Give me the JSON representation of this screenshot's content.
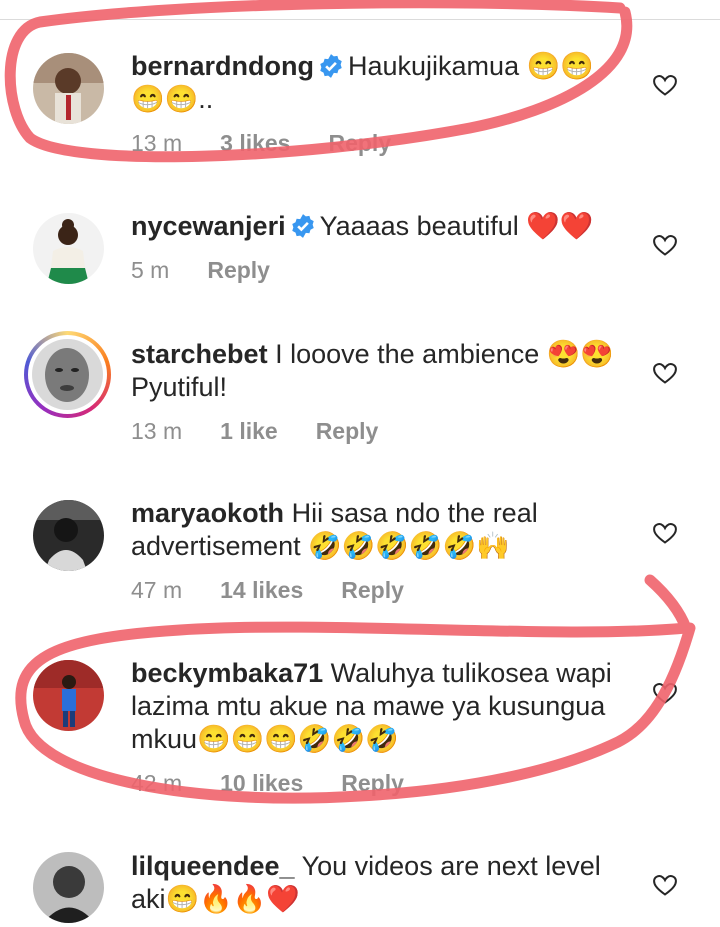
{
  "comments": [
    {
      "username": "bernardndong",
      "verified": true,
      "text": "Haukujikamua 😁😁\n😁😁..",
      "time": "13 m",
      "likes": "3 likes",
      "reply": "Reply"
    },
    {
      "username": "nycewanjeri",
      "verified": true,
      "text": "Yaaaas beautiful ❤️❤️",
      "time": "5 m",
      "likes": "",
      "reply": "Reply"
    },
    {
      "username": "starchebet",
      "verified": false,
      "story_ring": true,
      "text": "I looove the ambience 😍😍\nPyutiful!",
      "time": "13 m",
      "likes": "1 like",
      "reply": "Reply"
    },
    {
      "username": "maryaokoth",
      "verified": false,
      "text": "Hii sasa ndo the real\nadvertisement 🤣🤣🤣🤣🤣🙌",
      "time": "47 m",
      "likes": "14 likes",
      "reply": "Reply"
    },
    {
      "username": "beckymbaka71",
      "verified": false,
      "text": "Waluhya tulikosea wapi\nlazima mtu akue  na mawe ya kusungua\nmkuu😁😁😁🤣🤣🤣",
      "time": "42 m",
      "likes": "10 likes",
      "reply": "Reply"
    },
    {
      "username": "lilqueendee_",
      "verified": false,
      "text": "You videos are next level\naki😁🔥🔥❤️",
      "time": "",
      "likes": "",
      "reply": ""
    }
  ],
  "colors": {
    "verified_blue": "#3897f0",
    "annotation_red": "#f0636b",
    "meta_gray": "#8e8e8e"
  },
  "icons": {
    "like": "heart-outline-icon",
    "verified": "verified-badge-icon"
  }
}
